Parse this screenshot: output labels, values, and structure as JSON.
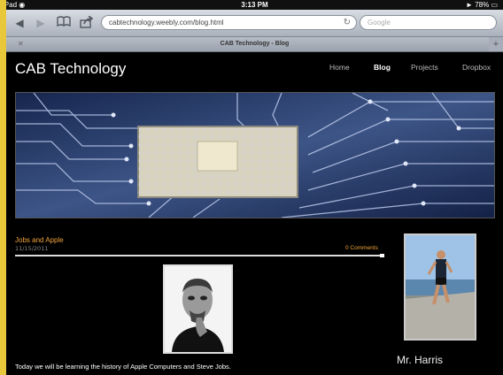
{
  "status": {
    "device": "iPad",
    "time": "3:13 PM",
    "battery": "78%"
  },
  "browser": {
    "url": "cabtechnology.weebly.com/blog.html",
    "search_placeholder": "Google",
    "tab_title": "CAB Technology - Blog"
  },
  "site": {
    "title": "CAB Technology",
    "nav": [
      "Home",
      "Blog",
      "Projects",
      "Dropbox"
    ],
    "active_nav": "Blog"
  },
  "post": {
    "title": "Jobs and Apple",
    "date": "11/15/2011",
    "comments": "0 Comments",
    "body": "Today we will be learning the history of Apple Computers and Steve Jobs."
  },
  "sidebar": {
    "name": "Mr. Harris"
  },
  "colors": {
    "accent": "#f2a43a",
    "background": "#000000"
  }
}
